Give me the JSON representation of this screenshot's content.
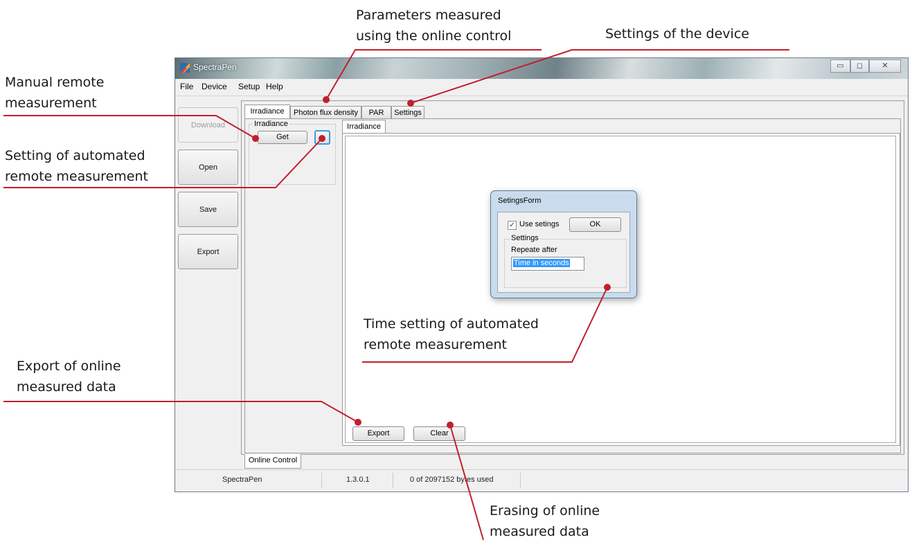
{
  "window": {
    "title": "SpectraPen",
    "menu": [
      "File",
      "Device",
      "Setup",
      "Help"
    ]
  },
  "sidebar": {
    "download": "Download",
    "open": "Open",
    "save": "Save",
    "export": "Export"
  },
  "tabs": {
    "top": [
      "Irradiance",
      "Photon flux density",
      "PAR",
      "Settings"
    ],
    "group_label": "Irradiance",
    "get_button": "Get",
    "inner_tab": "Irradiance",
    "export_button": "Export",
    "clear_button": "Clear",
    "bottom_tab": "Online Control"
  },
  "status": {
    "app": "SpectraPen",
    "version": "1.3.0.1",
    "memory": "0 of 2097152 bytes used"
  },
  "dialog": {
    "title": "SetingsForm",
    "checkbox_label": "Use setings",
    "checkbox_checked": true,
    "ok": "OK",
    "group_label": "Settings",
    "repeat_label": "Repeate after",
    "input_value": "Time in seconds"
  },
  "callouts": {
    "parameters": [
      "Parameters measured",
      "using the online control"
    ],
    "device_settings": [
      "Settings of the device"
    ],
    "manual": [
      "Manual remote",
      "measurement"
    ],
    "automated": [
      "Setting of automated",
      "remote measurement"
    ],
    "time_setting": [
      "Time setting of automated",
      "remote measurement"
    ],
    "export": [
      "Export of online",
      "measured data"
    ],
    "erasing": [
      "Erasing of online",
      "measured data"
    ]
  },
  "colors": {
    "annotation": "#c0202c",
    "selection": "#3399ff"
  }
}
